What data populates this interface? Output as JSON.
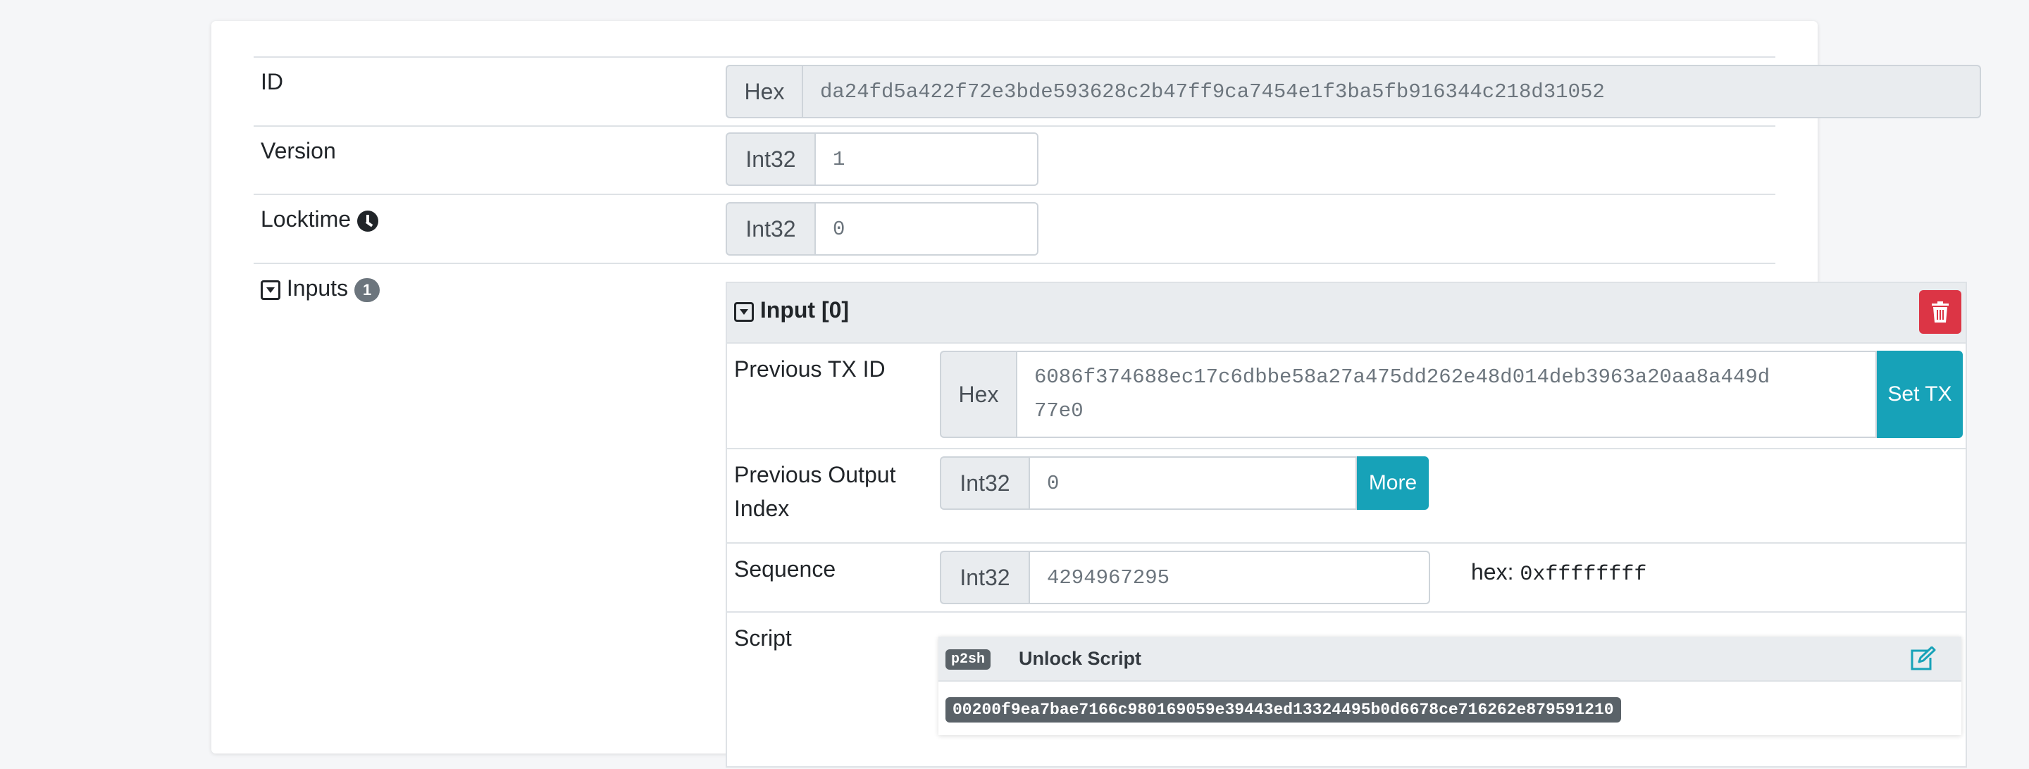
{
  "tx": {
    "id": {
      "label": "ID",
      "type": "Hex",
      "value": "da24fd5a422f72e3bde593628c2b47ff9ca7454e1f3ba5fb916344c218d31052"
    },
    "version": {
      "label": "Version",
      "type": "Int32",
      "value": "1"
    },
    "locktime": {
      "label": "Locktime",
      "type": "Int32",
      "value": "0",
      "icon": "clock-icon"
    },
    "inputs": {
      "label": "Inputs",
      "count": "1",
      "icon": "caret-square-down-icon"
    }
  },
  "input0": {
    "title": "Input [0]",
    "delete_icon": "trash-icon",
    "prev_txid": {
      "label": "Previous TX ID",
      "type": "Hex",
      "value_line1": "6086f374688ec17c6dbbe58a27a475dd262e48d014deb3963a20aa8a449d",
      "value_line2": "77e0",
      "button": "Set TX"
    },
    "prev_out_index": {
      "label_line1": "Previous Output",
      "label_line2": "Index",
      "type": "Int32",
      "value": "0",
      "button": "More"
    },
    "sequence": {
      "label": "Sequence",
      "type": "Int32",
      "value": "4294967295",
      "hex_label": "hex:",
      "hex_value": "0xffffffff"
    },
    "script": {
      "label": "Script",
      "badge": "p2sh",
      "title": "Unlock Script",
      "edit_icon": "edit-icon",
      "hex": "00200f9ea7bae7166c980169059e39443ed13324495b0d6678ce716262e879591210"
    }
  },
  "colors": {
    "danger": "#dc3545",
    "info": "#17a2b8",
    "muted": "#6c757d"
  }
}
